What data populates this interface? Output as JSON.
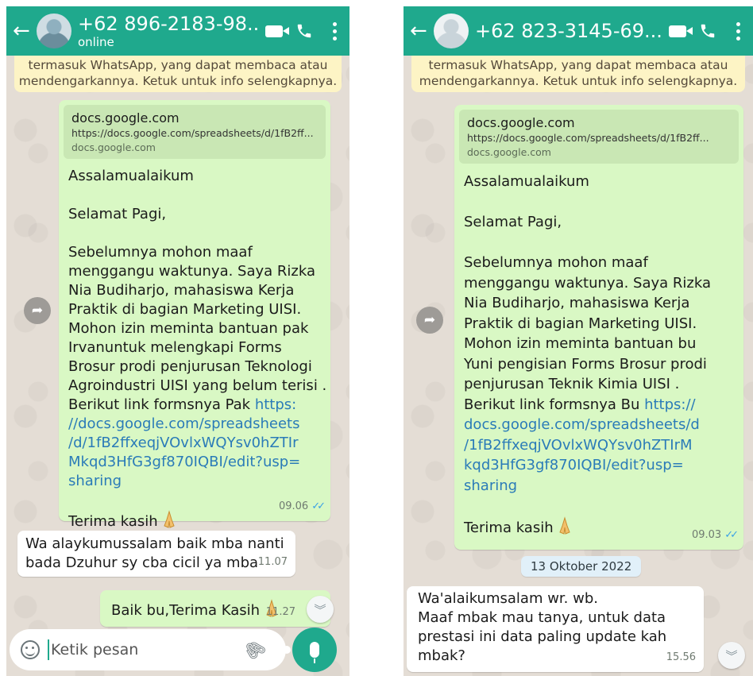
{
  "left": {
    "header": {
      "contact": "+62 896-2183-98...",
      "status": "online",
      "back_icon": "arrow-left-icon",
      "video_icon": "video-call-icon",
      "call_icon": "phone-icon",
      "menu_icon": "more-vertical-icon"
    },
    "notice": [
      "termasuk WhatsApp, yang dapat membaca atau",
      "mendengarkannya. Ketuk untuk info selengkapnya."
    ],
    "message": {
      "preview": {
        "title": "docs.google.com",
        "url": "https://docs.google.com/spreadsheets/d/1fB2ff...",
        "domain": "docs.google.com"
      },
      "lines": [
        "Assalamualaikum",
        "",
        "Selamat Pagi,",
        "",
        "Sebelumnya mohon maaf",
        "menggangu waktunya. Saya Rizka",
        "Nia Budiharjo, mahasiswa Kerja",
        "Praktik di bagian Marketing UISI.",
        "Mohon  izin meminta bantuan pak",
        "Irvanuntuk melengkapi Forms",
        "Brosur prodi penjurusan Teknologi",
        "Agroindustri UISI yang belum terisi .",
        "Berikut link formsnya Pak "
      ],
      "link_lines": [
        "https:",
        "//docs.google.com/spreadsheets",
        "/d/1fB2ffxeqjVOvlxWQYsv0hZTIr",
        "Mkqd3HfG3gf870IQBI/edit?usp=",
        "sharing"
      ],
      "closing": "Terima kasih",
      "time": "09.06"
    },
    "reply": {
      "lines": [
        "Wa alaykumussalam baik mba nanti",
        "bada Dzuhur sy cba cicil ya mba"
      ],
      "time": "11.07"
    },
    "sent": {
      "text": "Baik bu,Terima Kasih",
      "time": "11.27"
    },
    "input": {
      "placeholder": "Ketik pesan"
    }
  },
  "right": {
    "header": {
      "contact": "+62 823-3145-69...",
      "back_icon": "arrow-left-icon",
      "video_icon": "video-call-icon",
      "call_icon": "phone-icon",
      "menu_icon": "more-vertical-icon"
    },
    "notice": [
      "termasuk WhatsApp, yang dapat membaca atau",
      "mendengarkannya. Ketuk untuk info selengkapnya."
    ],
    "message": {
      "preview": {
        "title": "docs.google.com",
        "url": "https://docs.google.com/spreadsheets/d/1fB2ff...",
        "domain": "docs.google.com"
      },
      "lines": [
        "Assalamualaikum",
        "",
        "Selamat Pagi,",
        "",
        "Sebelumnya mohon maaf",
        "menggangu waktunya. Saya Rizka",
        "Nia Budiharjo, mahasiswa Kerja",
        "Praktik di bagian Marketing UISI.",
        "Mohon  izin meminta bantuan bu",
        "Yuni pengisian Forms Brosur prodi",
        "penjurusan Teknik Kimia UISI .",
        "Berikut link formsnya Bu "
      ],
      "link_lines": [
        "https://",
        "docs.google.com/spreadsheets/d",
        "/1fB2ffxeqjVOvlxWQYsv0hZTIrM",
        "kqd3HfG3gf870IQBI/edit?usp=",
        "sharing"
      ],
      "closing": "Terima kasih",
      "time": "09.03"
    },
    "date_chip": "13 Oktober 2022",
    "reply": {
      "lines": [
        "Wa'alaikumsalam wr. wb.",
        "Maaf mbak mau tanya, untuk data",
        "prestasi ini data paling update kah",
        "mbak?"
      ],
      "time": "15.56"
    }
  }
}
